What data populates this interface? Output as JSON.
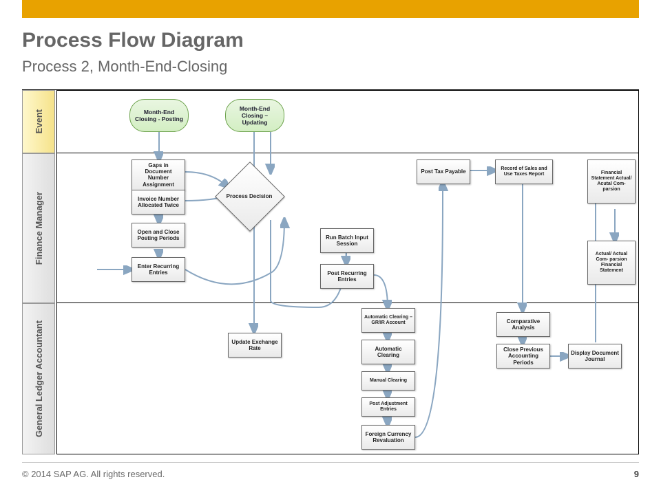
{
  "header": {
    "title": "Process Flow Diagram",
    "subtitle": "Process 2, Month-End-Closing"
  },
  "lanes": {
    "event": "Event",
    "finance_manager": "Finance Manager",
    "gla": "General Ledger Accountant"
  },
  "events": {
    "posting": "Month-End Closing - Posting",
    "updating": "Month-End Closing – Updating"
  },
  "decision": "Process Decision",
  "fm": {
    "gaps": "Gaps in Document Number Assignment",
    "invoice_twice": "Invoice Number Allocated Twice",
    "open_close": "Open and Close Posting Periods",
    "enter_recurring": "Enter Recurring Entries",
    "run_batch": "Run Batch Input Session",
    "post_recurring": "Post Recurring Entries",
    "post_tax": "Post Tax Payable",
    "sales_use_tax": "Record of Sales and Use Taxes Report",
    "fin_stmt_actual": "Financial Statement Actual/ Acutal Com- parsion",
    "actual_actual": "Actual/ Actual Com- parsion Financial Statement"
  },
  "gla": {
    "update_fx": "Update Exchange Rate",
    "auto_clear_grir": "Automatic Clearing – GR/IR Account",
    "auto_clear": "Automatic Clearing",
    "manual_clear": "Manual Clearing",
    "post_adj": "Post Adjustment Entries",
    "foreign_rev": "Foreign Currency Revaluation",
    "comp_analysis": "Comparative Analysis",
    "close_prev": "Close Previous Accounting Periods",
    "disp_doc_journal": "Display Document Journal"
  },
  "footer": {
    "copyright": "© 2014 SAP AG. All rights reserved.",
    "page": "9"
  }
}
